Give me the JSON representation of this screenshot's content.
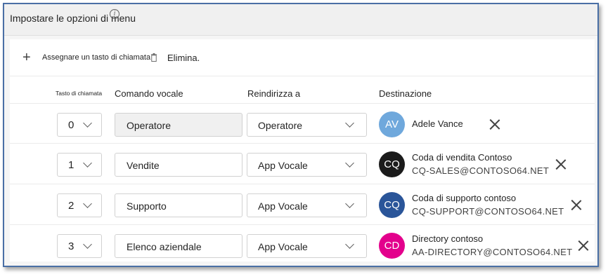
{
  "header": {
    "title": "Impostare le opzioni di menu",
    "info_icon": "info-icon"
  },
  "toolbar": {
    "add_label": "Assegnare un tasto di chiamata",
    "delete_label": "Elimina."
  },
  "columns": {
    "key": "Tasto di chiamata",
    "voice": "Comando vocale",
    "redirect": "Reindirizza a",
    "destination": "Destinazione"
  },
  "rows": [
    {
      "key": "0",
      "voice": "Operatore",
      "redirect": "Operatore",
      "avatar": "AV",
      "avatar_color": "#6fa8dc",
      "name": "Adele Vance",
      "email": ""
    },
    {
      "key": "1",
      "voice": "Vendite",
      "redirect": "App Vocale",
      "avatar": "CQ",
      "avatar_color": "#1b1b1b",
      "name": "Coda di vendita Contoso",
      "email": "CQ-SALES@CONTOSO64.NET"
    },
    {
      "key": "2",
      "voice": "Supporto",
      "redirect": "App Vocale",
      "avatar": "CQ",
      "avatar_color": "#2a5599",
      "name": "Coda di supporto contoso",
      "email": "CQ-SUPPORT@CONTOSO64.NET"
    },
    {
      "key": "3",
      "voice": "Elenco aziendale",
      "redirect": "App Vocale",
      "avatar": "CD",
      "avatar_color": "#e3008c",
      "name": "Directory contoso",
      "email": "AA-DIRECTORY@CONTOSO64.NET"
    }
  ]
}
